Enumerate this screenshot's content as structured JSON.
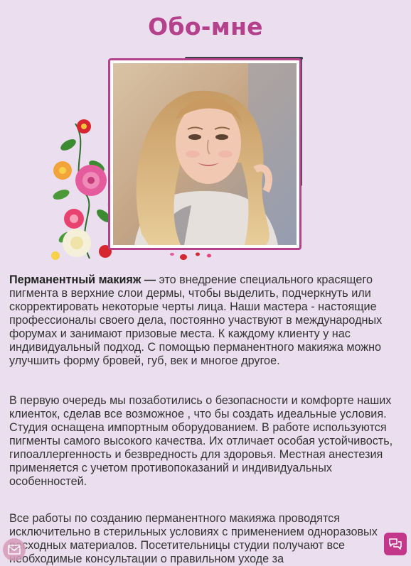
{
  "page": {
    "title": "Обо-мне"
  },
  "about": {
    "p1_bold": "Перманентный макияж —",
    "p1_rest": " это внедрение специального красящего пигмента в верхние слои дермы, чтобы выделить, подчеркнуть или скорректировать некоторые черты лица. Наши мастера - настоящие профессионалы своего дела, постоянно участвуют в международных форумах и занимают призовые места. К каждому клиенту у нас индивидуальный подход. С помощью перманентного макияжа можно улучшить форму бровей, губ, век и многое другое.",
    "p2": "В первую очередь мы позаботились о безопасности и комфорте наших клиенток, сделав все возможное , что бы создать идеальные условия. Студия оснащена импортным оборудованием. В работе используются пигменты самого высокого качества. Их отличает особая устойчивость, гипоаллергенность и безвредность для здоровья. Местная анестезия применяется с учетом противопоказаний и индивидуальных особенностей.",
    "p3": "Все работы по созданию перманентного макияжа проводятся исключительно в стерильных условиях с применением одноразовых расходных материалов. Посетительницы студии получают все необходимые консультации о правильном уходе за"
  },
  "colors": {
    "accent": "#b5418c",
    "background": "#ebdfef",
    "frame_dark": "#3b3f47"
  },
  "icons": {
    "chat": "chat-bubbles-icon",
    "left_widget": "mail-icon"
  }
}
